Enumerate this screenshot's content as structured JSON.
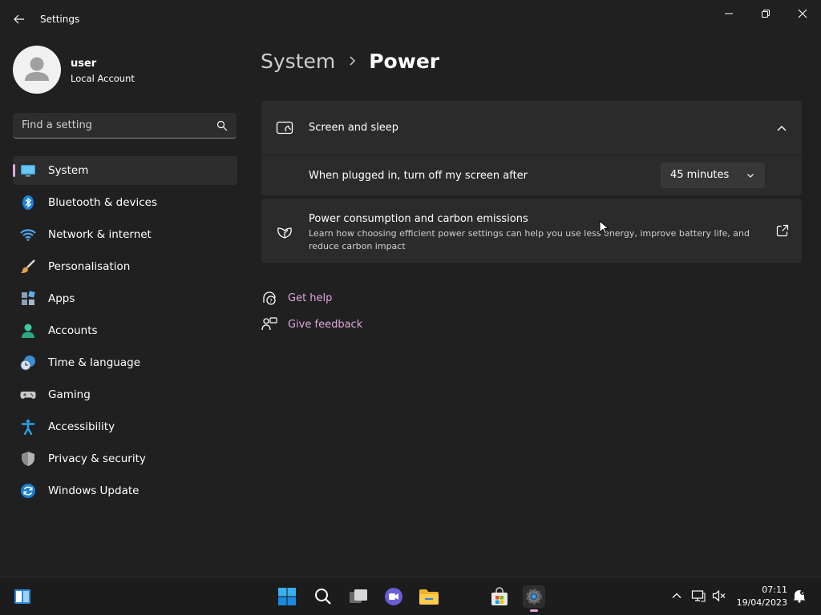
{
  "window": {
    "title": "Settings"
  },
  "profile": {
    "name": "user",
    "account_type": "Local Account"
  },
  "search": {
    "placeholder": "Find a setting"
  },
  "nav": {
    "items": [
      {
        "label": "System",
        "icon": "system-display-icon",
        "selected": true
      },
      {
        "label": "Bluetooth & devices",
        "icon": "bluetooth-icon"
      },
      {
        "label": "Network & internet",
        "icon": "wifi-icon"
      },
      {
        "label": "Personalisation",
        "icon": "paintbrush-icon"
      },
      {
        "label": "Apps",
        "icon": "apps-icon"
      },
      {
        "label": "Accounts",
        "icon": "accounts-icon"
      },
      {
        "label": "Time & language",
        "icon": "clock-globe-icon"
      },
      {
        "label": "Gaming",
        "icon": "gamepad-icon"
      },
      {
        "label": "Accessibility",
        "icon": "accessibility-icon"
      },
      {
        "label": "Privacy & security",
        "icon": "shield-icon"
      },
      {
        "label": "Windows Update",
        "icon": "update-icon"
      }
    ]
  },
  "breadcrumb": {
    "parent": "System",
    "current": "Power"
  },
  "main": {
    "screen_sleep": {
      "title": "Screen and sleep",
      "plugged_label": "When plugged in, turn off my screen after",
      "plugged_value": "45 minutes"
    },
    "power_consumption": {
      "title": "Power consumption and carbon emissions",
      "description": "Learn how choosing efficient power settings can help you use less energy, improve battery life, and reduce carbon impact"
    },
    "help": {
      "get_help": "Get help",
      "give_feedback": "Give feedback"
    }
  },
  "taskbar": {
    "time": "07:11",
    "date": "19/04/2023"
  },
  "colors": {
    "accent": "#e0a7dc",
    "background": "#202020",
    "card": "#2b2b2b"
  }
}
